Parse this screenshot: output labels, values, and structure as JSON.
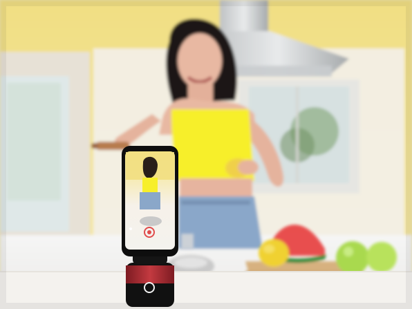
{
  "scene": {
    "colors": {
      "wall": "#f1df83",
      "wall_light": "#f6eab3",
      "counter": "#f4f2ee",
      "top_yellow": "#f7ef2a",
      "jeans": "#8aa7c9",
      "skin": "#e8b8a2",
      "hair": "#1e1512",
      "mount_red": "#b3262e",
      "mount_black": "#121212"
    },
    "icons": {
      "mount_button": "power-ring-icon",
      "record_button": "record-icon"
    }
  }
}
